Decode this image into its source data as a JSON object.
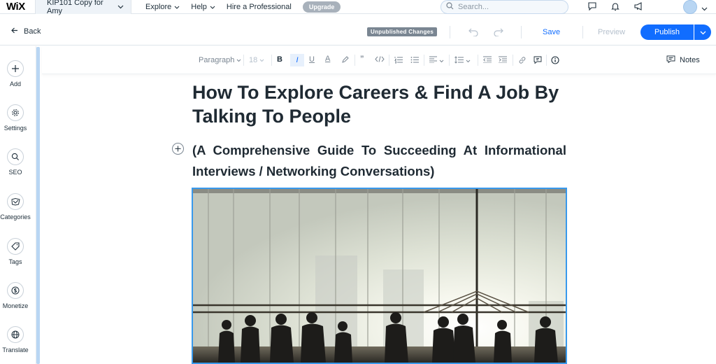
{
  "topbar": {
    "logo": "WiX",
    "site_name": "KIP101 Copy for Amy",
    "menu": [
      {
        "label": "Explore"
      },
      {
        "label": "Help"
      },
      {
        "label": "Hire a Professional"
      }
    ],
    "upgrade_label": "Upgrade",
    "search_placeholder": "Search..."
  },
  "actionbar": {
    "back_label": "Back",
    "status_badge": "Unpublished Changes",
    "save_label": "Save",
    "preview_label": "Preview",
    "publish_label": "Publish"
  },
  "sidebar": {
    "items": [
      {
        "label": "Add",
        "icon": "plus-icon"
      },
      {
        "label": "Settings",
        "icon": "gear-icon"
      },
      {
        "label": "SEO",
        "icon": "search-icon"
      },
      {
        "label": "Categories",
        "icon": "categories-icon"
      },
      {
        "label": "Tags",
        "icon": "tag-icon"
      },
      {
        "label": "Monetize",
        "icon": "dollar-icon"
      },
      {
        "label": "Translate",
        "icon": "globe-icon"
      }
    ]
  },
  "toolbar": {
    "paragraph_style": "Paragraph",
    "font_size": "18",
    "notes_label": "Notes"
  },
  "post": {
    "title": "How To Explore Careers & Find A Job By Talking To People",
    "subtitle": "(A Comprehensive Guide To Succeeding At Informational Interviews / Networking Conversations)"
  },
  "colors": {
    "accent": "#116dff",
    "selection": "#3899ec",
    "badge": "#7a8692"
  }
}
